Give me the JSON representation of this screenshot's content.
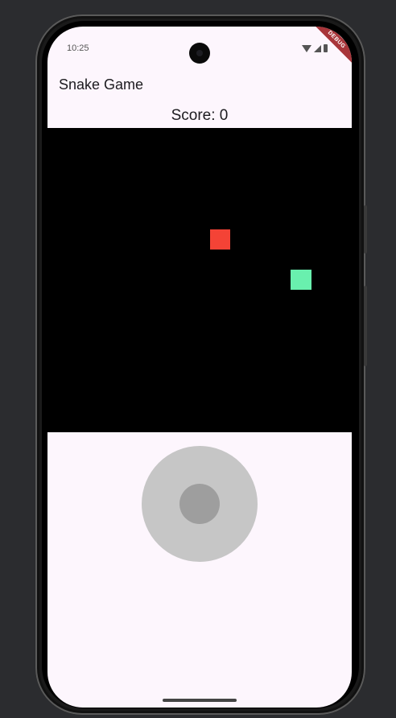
{
  "status_bar": {
    "time": "10:25",
    "icons": [
      "wifi-icon",
      "signal-icon",
      "battery-icon"
    ]
  },
  "debug_banner": "DEBUG",
  "app_bar": {
    "title": "Snake Game"
  },
  "score": {
    "label": "Score: 0"
  },
  "game": {
    "board_color": "#000000",
    "food_color": "#f44336",
    "snake_color": "#69f0ae"
  },
  "joystick": {
    "base_color": "#c6c6c6",
    "knob_color": "#9e9e9e"
  },
  "colors": {
    "app_background": "#fdf6fd",
    "debug_ribbon": "#a8353a"
  }
}
